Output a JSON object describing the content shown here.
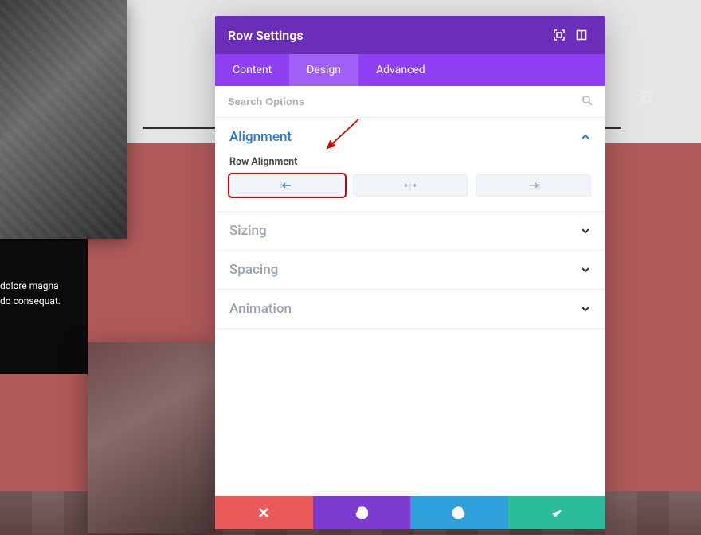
{
  "background": {
    "heading_fragment": "a",
    "lorem_line1": "dolore magna",
    "lorem_line2": "do consequat."
  },
  "modal": {
    "title": "Row Settings",
    "tabs": {
      "content": "Content",
      "design": "Design",
      "advanced": "Advanced",
      "active": "design"
    },
    "search_placeholder": "Search Options",
    "sections": {
      "alignment": {
        "title": "Alignment",
        "field_label": "Row Alignment",
        "options": {
          "left": "align-left",
          "center": "align-center",
          "right": "align-right",
          "selected": "left"
        }
      },
      "sizing": {
        "title": "Sizing"
      },
      "spacing": {
        "title": "Spacing"
      },
      "animation": {
        "title": "Animation"
      }
    },
    "footer": {
      "cancel": "cancel",
      "undo": "undo",
      "redo": "redo",
      "save": "save"
    }
  }
}
